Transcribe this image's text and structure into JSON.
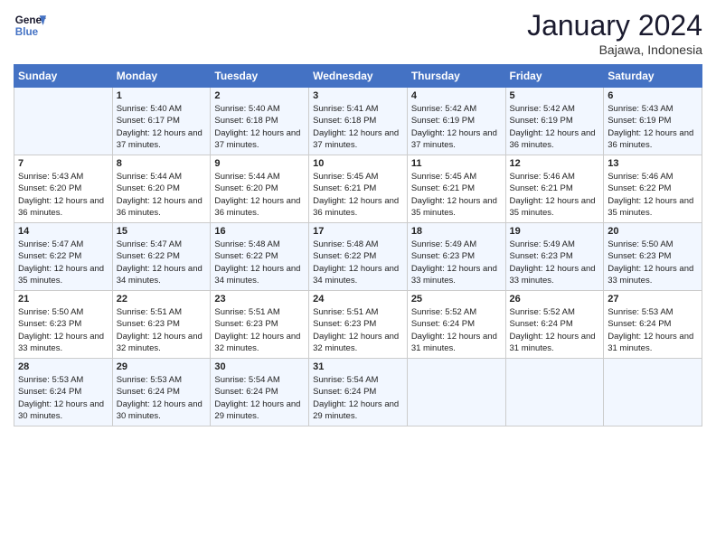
{
  "header": {
    "logo_line1": "General",
    "logo_line2": "Blue",
    "month_title": "January 2024",
    "location": "Bajawa, Indonesia"
  },
  "days_of_week": [
    "Sunday",
    "Monday",
    "Tuesday",
    "Wednesday",
    "Thursday",
    "Friday",
    "Saturday"
  ],
  "weeks": [
    [
      {
        "day": "",
        "sunrise": "",
        "sunset": "",
        "daylight": ""
      },
      {
        "day": "1",
        "sunrise": "Sunrise: 5:40 AM",
        "sunset": "Sunset: 6:17 PM",
        "daylight": "Daylight: 12 hours and 37 minutes."
      },
      {
        "day": "2",
        "sunrise": "Sunrise: 5:40 AM",
        "sunset": "Sunset: 6:18 PM",
        "daylight": "Daylight: 12 hours and 37 minutes."
      },
      {
        "day": "3",
        "sunrise": "Sunrise: 5:41 AM",
        "sunset": "Sunset: 6:18 PM",
        "daylight": "Daylight: 12 hours and 37 minutes."
      },
      {
        "day": "4",
        "sunrise": "Sunrise: 5:42 AM",
        "sunset": "Sunset: 6:19 PM",
        "daylight": "Daylight: 12 hours and 37 minutes."
      },
      {
        "day": "5",
        "sunrise": "Sunrise: 5:42 AM",
        "sunset": "Sunset: 6:19 PM",
        "daylight": "Daylight: 12 hours and 36 minutes."
      },
      {
        "day": "6",
        "sunrise": "Sunrise: 5:43 AM",
        "sunset": "Sunset: 6:19 PM",
        "daylight": "Daylight: 12 hours and 36 minutes."
      }
    ],
    [
      {
        "day": "7",
        "sunrise": "Sunrise: 5:43 AM",
        "sunset": "Sunset: 6:20 PM",
        "daylight": "Daylight: 12 hours and 36 minutes."
      },
      {
        "day": "8",
        "sunrise": "Sunrise: 5:44 AM",
        "sunset": "Sunset: 6:20 PM",
        "daylight": "Daylight: 12 hours and 36 minutes."
      },
      {
        "day": "9",
        "sunrise": "Sunrise: 5:44 AM",
        "sunset": "Sunset: 6:20 PM",
        "daylight": "Daylight: 12 hours and 36 minutes."
      },
      {
        "day": "10",
        "sunrise": "Sunrise: 5:45 AM",
        "sunset": "Sunset: 6:21 PM",
        "daylight": "Daylight: 12 hours and 36 minutes."
      },
      {
        "day": "11",
        "sunrise": "Sunrise: 5:45 AM",
        "sunset": "Sunset: 6:21 PM",
        "daylight": "Daylight: 12 hours and 35 minutes."
      },
      {
        "day": "12",
        "sunrise": "Sunrise: 5:46 AM",
        "sunset": "Sunset: 6:21 PM",
        "daylight": "Daylight: 12 hours and 35 minutes."
      },
      {
        "day": "13",
        "sunrise": "Sunrise: 5:46 AM",
        "sunset": "Sunset: 6:22 PM",
        "daylight": "Daylight: 12 hours and 35 minutes."
      }
    ],
    [
      {
        "day": "14",
        "sunrise": "Sunrise: 5:47 AM",
        "sunset": "Sunset: 6:22 PM",
        "daylight": "Daylight: 12 hours and 35 minutes."
      },
      {
        "day": "15",
        "sunrise": "Sunrise: 5:47 AM",
        "sunset": "Sunset: 6:22 PM",
        "daylight": "Daylight: 12 hours and 34 minutes."
      },
      {
        "day": "16",
        "sunrise": "Sunrise: 5:48 AM",
        "sunset": "Sunset: 6:22 PM",
        "daylight": "Daylight: 12 hours and 34 minutes."
      },
      {
        "day": "17",
        "sunrise": "Sunrise: 5:48 AM",
        "sunset": "Sunset: 6:22 PM",
        "daylight": "Daylight: 12 hours and 34 minutes."
      },
      {
        "day": "18",
        "sunrise": "Sunrise: 5:49 AM",
        "sunset": "Sunset: 6:23 PM",
        "daylight": "Daylight: 12 hours and 33 minutes."
      },
      {
        "day": "19",
        "sunrise": "Sunrise: 5:49 AM",
        "sunset": "Sunset: 6:23 PM",
        "daylight": "Daylight: 12 hours and 33 minutes."
      },
      {
        "day": "20",
        "sunrise": "Sunrise: 5:50 AM",
        "sunset": "Sunset: 6:23 PM",
        "daylight": "Daylight: 12 hours and 33 minutes."
      }
    ],
    [
      {
        "day": "21",
        "sunrise": "Sunrise: 5:50 AM",
        "sunset": "Sunset: 6:23 PM",
        "daylight": "Daylight: 12 hours and 33 minutes."
      },
      {
        "day": "22",
        "sunrise": "Sunrise: 5:51 AM",
        "sunset": "Sunset: 6:23 PM",
        "daylight": "Daylight: 12 hours and 32 minutes."
      },
      {
        "day": "23",
        "sunrise": "Sunrise: 5:51 AM",
        "sunset": "Sunset: 6:23 PM",
        "daylight": "Daylight: 12 hours and 32 minutes."
      },
      {
        "day": "24",
        "sunrise": "Sunrise: 5:51 AM",
        "sunset": "Sunset: 6:23 PM",
        "daylight": "Daylight: 12 hours and 32 minutes."
      },
      {
        "day": "25",
        "sunrise": "Sunrise: 5:52 AM",
        "sunset": "Sunset: 6:24 PM",
        "daylight": "Daylight: 12 hours and 31 minutes."
      },
      {
        "day": "26",
        "sunrise": "Sunrise: 5:52 AM",
        "sunset": "Sunset: 6:24 PM",
        "daylight": "Daylight: 12 hours and 31 minutes."
      },
      {
        "day": "27",
        "sunrise": "Sunrise: 5:53 AM",
        "sunset": "Sunset: 6:24 PM",
        "daylight": "Daylight: 12 hours and 31 minutes."
      }
    ],
    [
      {
        "day": "28",
        "sunrise": "Sunrise: 5:53 AM",
        "sunset": "Sunset: 6:24 PM",
        "daylight": "Daylight: 12 hours and 30 minutes."
      },
      {
        "day": "29",
        "sunrise": "Sunrise: 5:53 AM",
        "sunset": "Sunset: 6:24 PM",
        "daylight": "Daylight: 12 hours and 30 minutes."
      },
      {
        "day": "30",
        "sunrise": "Sunrise: 5:54 AM",
        "sunset": "Sunset: 6:24 PM",
        "daylight": "Daylight: 12 hours and 29 minutes."
      },
      {
        "day": "31",
        "sunrise": "Sunrise: 5:54 AM",
        "sunset": "Sunset: 6:24 PM",
        "daylight": "Daylight: 12 hours and 29 minutes."
      },
      {
        "day": "",
        "sunrise": "",
        "sunset": "",
        "daylight": ""
      },
      {
        "day": "",
        "sunrise": "",
        "sunset": "",
        "daylight": ""
      },
      {
        "day": "",
        "sunrise": "",
        "sunset": "",
        "daylight": ""
      }
    ]
  ]
}
